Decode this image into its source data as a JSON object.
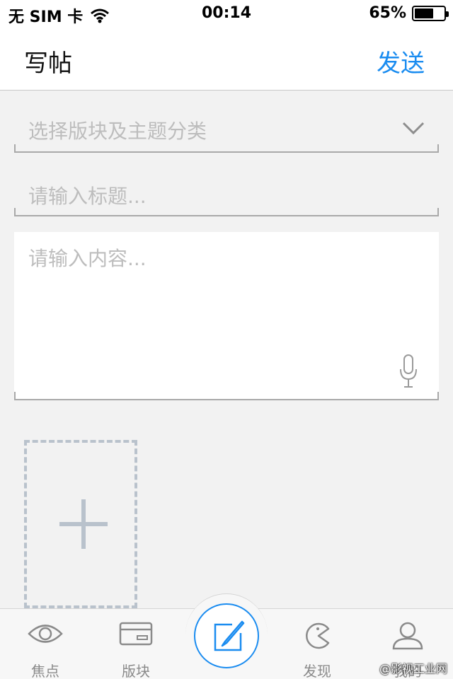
{
  "status_bar": {
    "carrier": "无 SIM 卡",
    "time": "00:14",
    "battery_text": "65%",
    "battery_level": 0.65
  },
  "nav": {
    "title": "写帖",
    "send_label": "发送"
  },
  "form": {
    "category_placeholder": "选择版块及主题分类",
    "title_placeholder": "请输入标题...",
    "content_placeholder": "请输入内容..."
  },
  "tabs": [
    {
      "label": "焦点",
      "icon": "eye-icon"
    },
    {
      "label": "版块",
      "icon": "card-icon"
    },
    {
      "label": "",
      "icon": "compose-icon"
    },
    {
      "label": "发现",
      "icon": "pacman-icon"
    },
    {
      "label": "我的",
      "icon": "user-icon"
    }
  ],
  "watermark": "@影视工业网",
  "colors": {
    "accent": "#1a8cf0",
    "placeholder": "#bdbdbd",
    "background": "#f2f2f2"
  }
}
